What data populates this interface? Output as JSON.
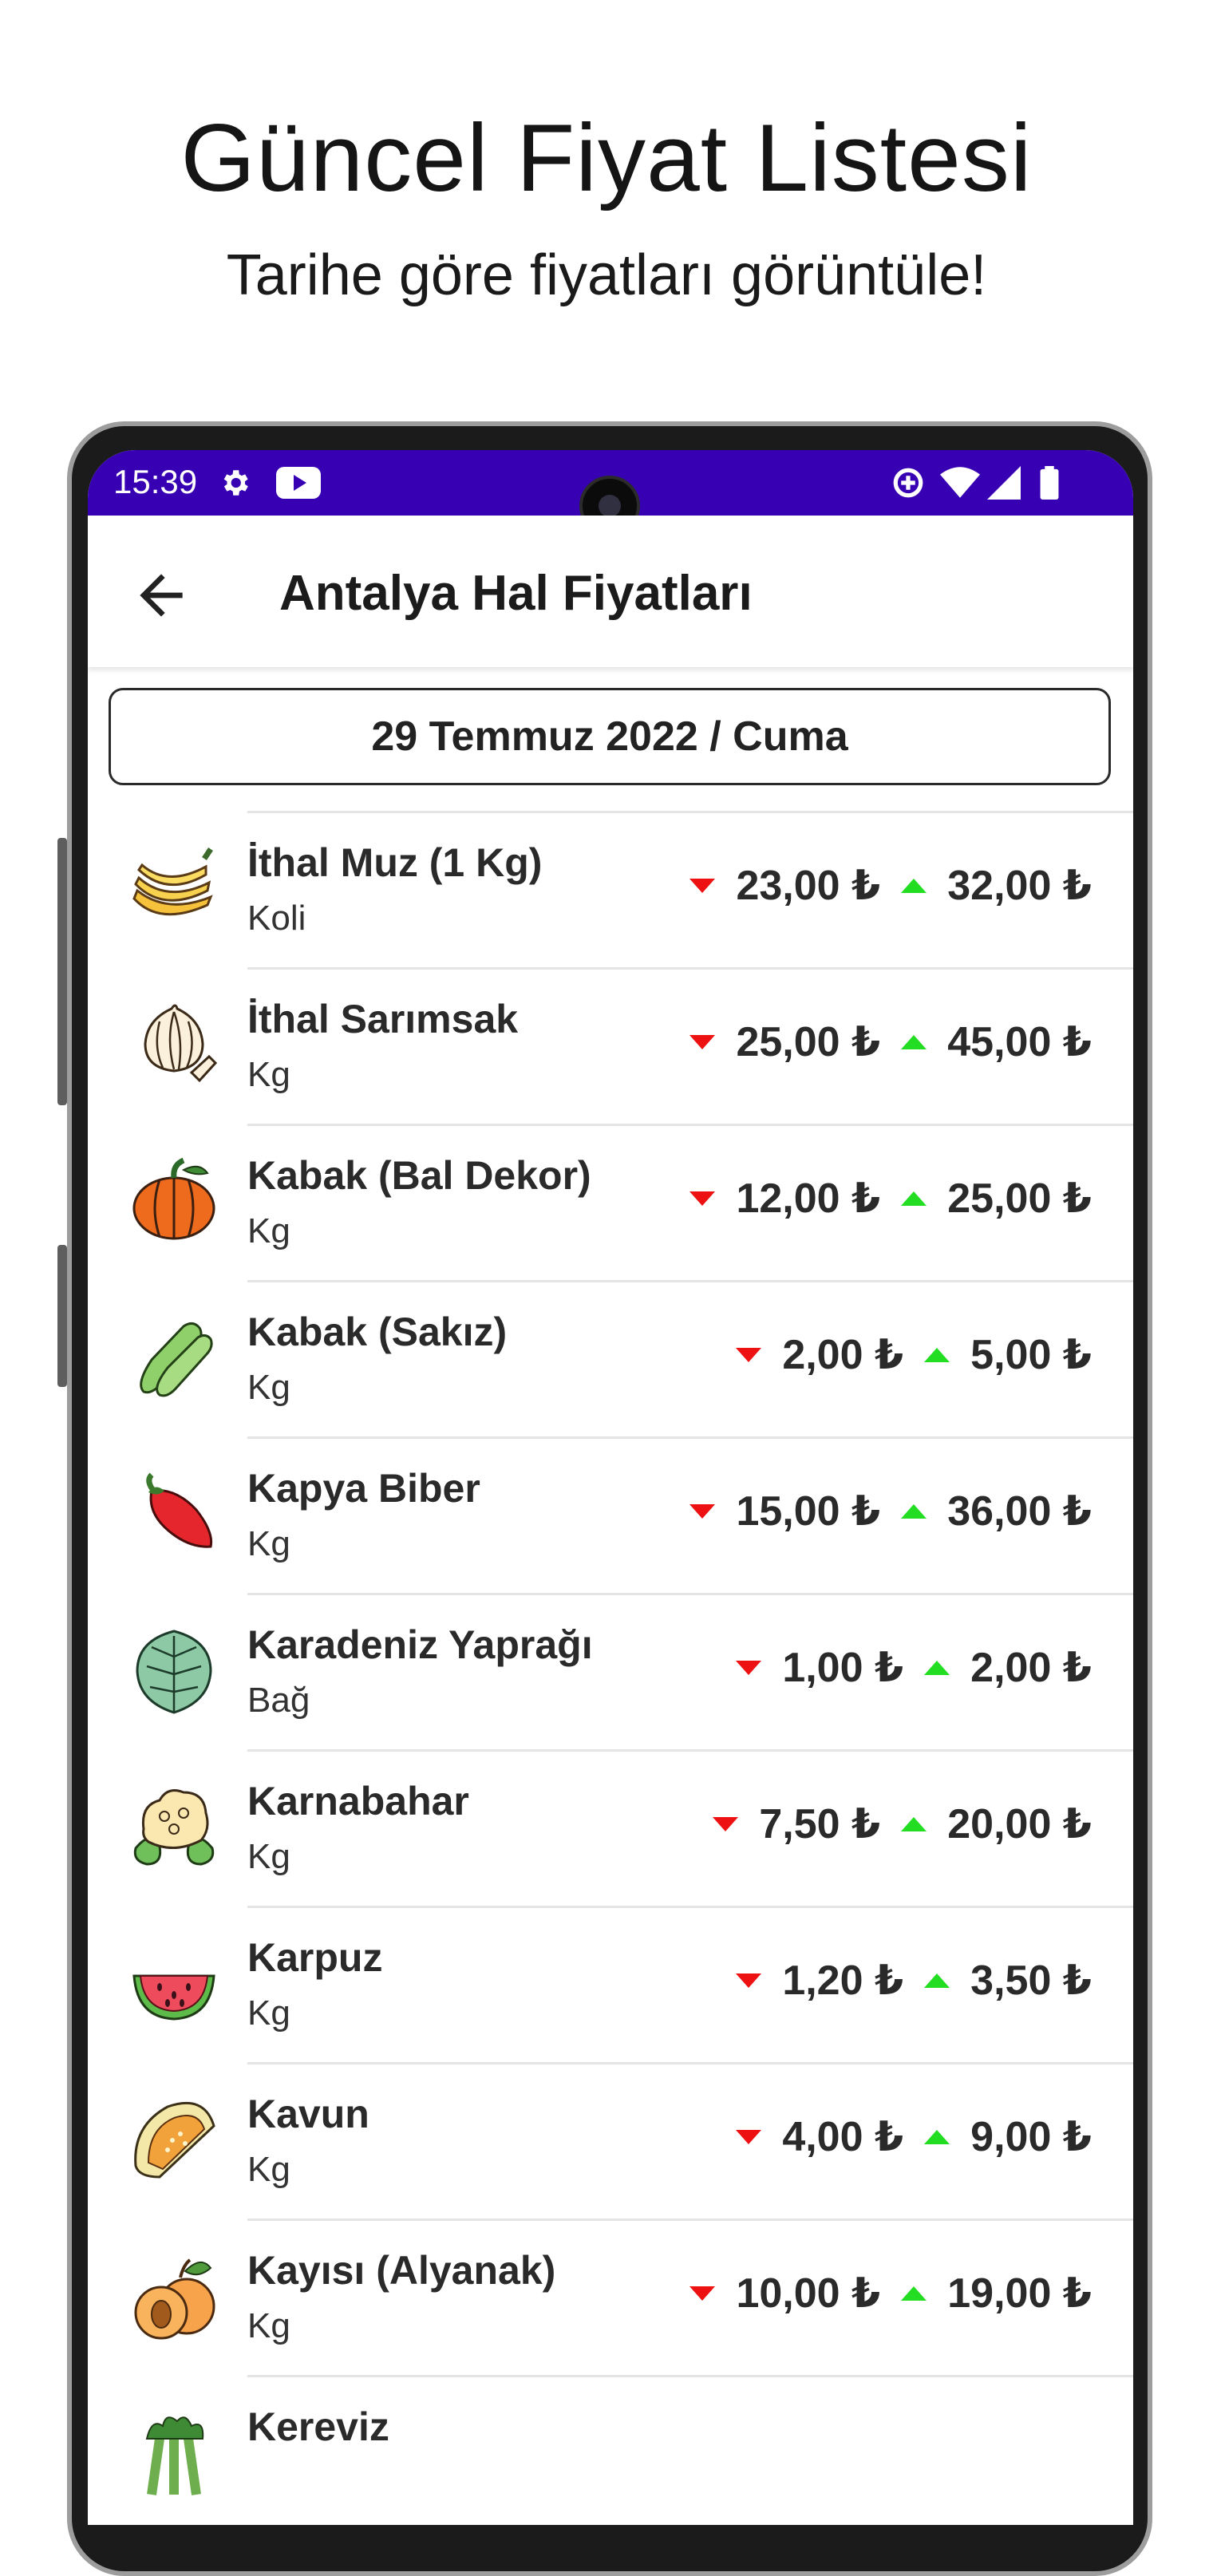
{
  "promo": {
    "title": "Güncel Fiyat Listesi",
    "subtitle": "Tarihe göre fiyatları görüntüle!"
  },
  "status_bar": {
    "time": "15:39",
    "left_icons": [
      "gear-icon",
      "youtube-icon"
    ],
    "right_icons": [
      "data-saver-icon",
      "wifi-icon",
      "signal-icon",
      "battery-icon"
    ],
    "color": "#3700b3"
  },
  "app_bar": {
    "title": "Antalya Hal Fiyatları",
    "back_icon": "arrow-back-icon"
  },
  "date_selector": {
    "label": "29 Temmuz 2022 / Cuma"
  },
  "colors": {
    "down": "#ee1111",
    "up": "#22dd22"
  },
  "products": [
    {
      "name": "İthal Muz (1 Kg)",
      "unit": "Koli",
      "min": "23,00 ₺",
      "max": "32,00 ₺",
      "icon": "banana-icon"
    },
    {
      "name": "İthal Sarımsak",
      "unit": "Kg",
      "min": "25,00 ₺",
      "max": "45,00 ₺",
      "icon": "garlic-icon"
    },
    {
      "name": "Kabak (Bal Dekor)",
      "unit": "Kg",
      "min": "12,00 ₺",
      "max": "25,00 ₺",
      "icon": "pumpkin-icon"
    },
    {
      "name": "Kabak (Sakız)",
      "unit": "Kg",
      "min": "2,00 ₺",
      "max": "5,00 ₺",
      "icon": "zucchini-icon"
    },
    {
      "name": "Kapya Biber",
      "unit": "Kg",
      "min": "15,00 ₺",
      "max": "36,00 ₺",
      "icon": "red-pepper-icon"
    },
    {
      "name": "Karadeniz Yaprağı",
      "unit": "Bağ",
      "min": "1,00 ₺",
      "max": "2,00 ₺",
      "icon": "collard-leaf-icon"
    },
    {
      "name": "Karnabahar",
      "unit": "Kg",
      "min": "7,50 ₺",
      "max": "20,00 ₺",
      "icon": "cauliflower-icon"
    },
    {
      "name": "Karpuz",
      "unit": "Kg",
      "min": "1,20 ₺",
      "max": "3,50 ₺",
      "icon": "watermelon-icon"
    },
    {
      "name": "Kavun",
      "unit": "Kg",
      "min": "4,00 ₺",
      "max": "9,00 ₺",
      "icon": "melon-icon"
    },
    {
      "name": "Kayısı (Alyanak)",
      "unit": "Kg",
      "min": "10,00 ₺",
      "max": "19,00 ₺",
      "icon": "apricot-icon"
    },
    {
      "name": "Kereviz",
      "unit": "",
      "min": "",
      "max": "",
      "icon": "celery-icon"
    }
  ]
}
